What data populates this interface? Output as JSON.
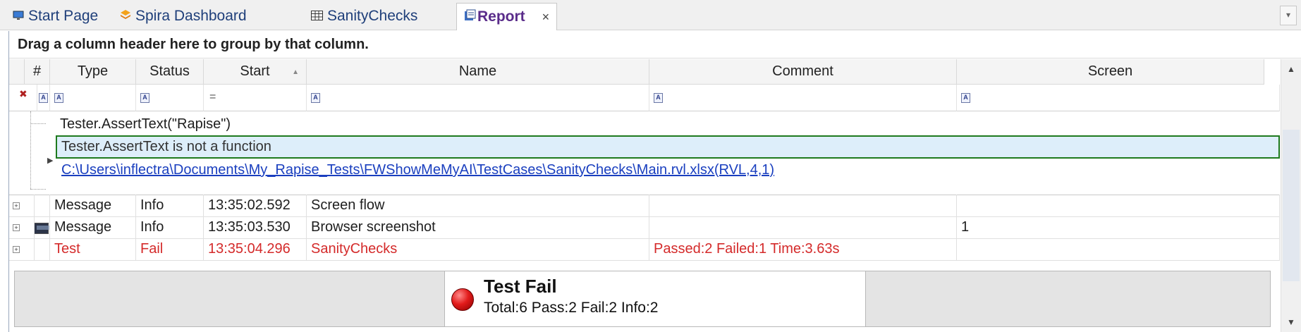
{
  "tabs": [
    {
      "label": "Start Page",
      "icon": "monitor-icon"
    },
    {
      "label": "Spira Dashboard",
      "icon": "spira-icon"
    },
    {
      "label": "SanityChecks",
      "icon": "table-icon"
    },
    {
      "label": "Report",
      "icon": "report-icon",
      "active": true
    }
  ],
  "tab_close": "×",
  "group_hint": "Drag a column header here to group by that column.",
  "columns": {
    "num": "#",
    "type": "Type",
    "status": "Status",
    "start": "Start",
    "name": "Name",
    "comment": "Comment",
    "screen": "Screen"
  },
  "filter_eq": "=",
  "detail": {
    "line1": "Tester.AssertText(\"Rapise\")",
    "line2": "Tester.AssertText is not a function",
    "link": "C:\\Users\\inflectra\\Documents\\My_Rapise_Tests\\FWShowMeMyAI\\TestCases\\SanityChecks\\Main.rvl.xlsx(RVL,4,1)"
  },
  "rows": [
    {
      "type": "Message",
      "status": "Info",
      "start": "13:35:02.592",
      "name": "Screen flow",
      "comment": "",
      "screen": ""
    },
    {
      "type": "Message",
      "status": "Info",
      "start": "13:35:03.530",
      "name": "Browser screenshot",
      "comment": "",
      "screen": "1"
    },
    {
      "type": "Test",
      "status": "Fail",
      "start": "13:35:04.296",
      "name": "SanityChecks",
      "comment": "Passed:2 Failed:1 Time:3.63s",
      "screen": ""
    }
  ],
  "summary": {
    "title": "Test Fail",
    "stats": "Total:6 Pass:2 Fail:2 Info:2"
  },
  "colors": {
    "fail_text": "#d42a2a",
    "selection_border": "#1e7a1e",
    "link": "#1a3fbf"
  }
}
